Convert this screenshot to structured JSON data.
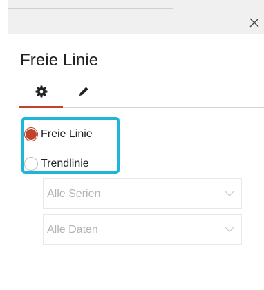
{
  "panel": {
    "title": "Freie Linie",
    "close_icon": "close-icon",
    "tabs": [
      {
        "name": "settings",
        "icon": "gear-icon",
        "active": true
      },
      {
        "name": "edit",
        "icon": "pencil-icon",
        "active": false
      }
    ],
    "line_type": {
      "options": [
        {
          "label": "Freie Linie",
          "checked": true
        },
        {
          "label": "Trendlinie",
          "checked": false
        }
      ],
      "highlight_color": "#1fb5d9"
    },
    "series_select": {
      "value": "Alle Serien",
      "icon": "chevron-down-icon"
    },
    "data_select": {
      "value": "Alle Daten",
      "icon": "chevron-down-icon"
    }
  },
  "colors": {
    "accent": "#c0432b",
    "highlight": "#1fb5d9",
    "muted_text": "#b3b3b3"
  }
}
